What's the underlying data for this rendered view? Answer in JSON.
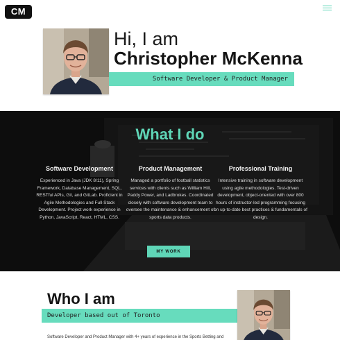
{
  "header": {
    "logo_text": "CM",
    "menu_icon": "hamburger-menu-icon"
  },
  "hero": {
    "greeting": "Hi, I am",
    "name": "Christopher McKenna",
    "tagline": "Software Developer & Product Manager"
  },
  "what_i_do": {
    "title": "What I do",
    "columns": [
      {
        "heading": "Software Development",
        "text": "Experienced in Java (JDK 8/11), Spring Framework, Database Management, SQL, RESTful APIs, Git, and GitLab. Proficient in Agile Methodologies and Full-Stack Development. Project work experience in Python, JavaScript, React, HTML, CSS."
      },
      {
        "heading": "Product Management",
        "text": "Managed a portfolio of football statistics services with clients such as William Hill, Paddy Power, and Ladbrokes. Coordinated closely with software development team to oversee the maintenance & enhancement of sports data products."
      },
      {
        "heading": "Professional Training",
        "text": "Intensive training in software development using agile methodologies. Test-driven development, object-oriented with over 800 hours of instructor-led programming focusing on up-to-date best practices & fundamentals of design."
      }
    ],
    "button_label": "MY WORK"
  },
  "who_i_am": {
    "title": "Who I am",
    "subtitle": "Developer based out of Toronto",
    "intro": "Software Developer and Product Manager with 4+ years of experience in the Sports Betting and"
  },
  "colors": {
    "accent": "#5fd6b7",
    "accent_bar": "#67dcbd",
    "dark_section": "#161616"
  }
}
